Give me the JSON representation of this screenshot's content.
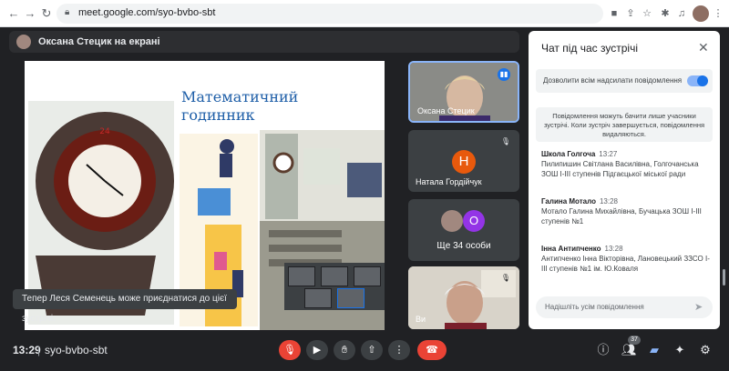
{
  "browser": {
    "url": "meet.google.com/syo-bvbo-sbt"
  },
  "presenter": {
    "label": "Оксана Стецик на екрані"
  },
  "slide": {
    "title_line1": "Математичний",
    "title_line2": "годинник"
  },
  "tiles": [
    {
      "name": "Оксана Стецик",
      "mic": "speaking"
    },
    {
      "name": "Натала Гордійчук",
      "initial": "Н",
      "color": "#e8590c",
      "mic": "muted"
    },
    {
      "others_label": "Ще 34 особи",
      "initial": "О",
      "color": "#9334e6"
    },
    {
      "name": "Ви",
      "mic": "muted"
    }
  ],
  "toast": "Тепер Леся Семенець може приєднатися до цієї зустрічі.",
  "bottom": {
    "time": "13:29",
    "separator": "|",
    "meeting_code": "syo-bvbo-sbt",
    "participants_count": "37"
  },
  "chat": {
    "title": "Чат під час зустрічі",
    "allow_label": "Дозволити всім надсилати повідомлення",
    "notice": "Повідомлення можуть бачити лише учасники зустрічі. Коли зустріч завершується, повідомлення видаляються.",
    "messages": [
      {
        "sender": "Школа Голгоча",
        "time": "13:27",
        "text": "Пилипишин Світлана Василівна, Голгочанська ЗОШ І-ІІІ ступенів Підгаєцької міської ради"
      },
      {
        "sender": "Галина Мотало",
        "time": "13:28",
        "text": "Мотало Галина Михайлівна, Бучацька ЗОШ І-ІІІ ступенів №1"
      },
      {
        "sender": "Інна Антипченко",
        "time": "13:28",
        "text": "Антипченко Інна Вікторівна, Лановецький ЗЗСО І-ІІІ ступенів №1 ім. Ю.Коваля"
      }
    ],
    "input_placeholder": "Надішліть усім повідомлення"
  },
  "colors": {
    "background": "#202124",
    "accent": "#1a73e8",
    "end_call": "#ea4335"
  }
}
